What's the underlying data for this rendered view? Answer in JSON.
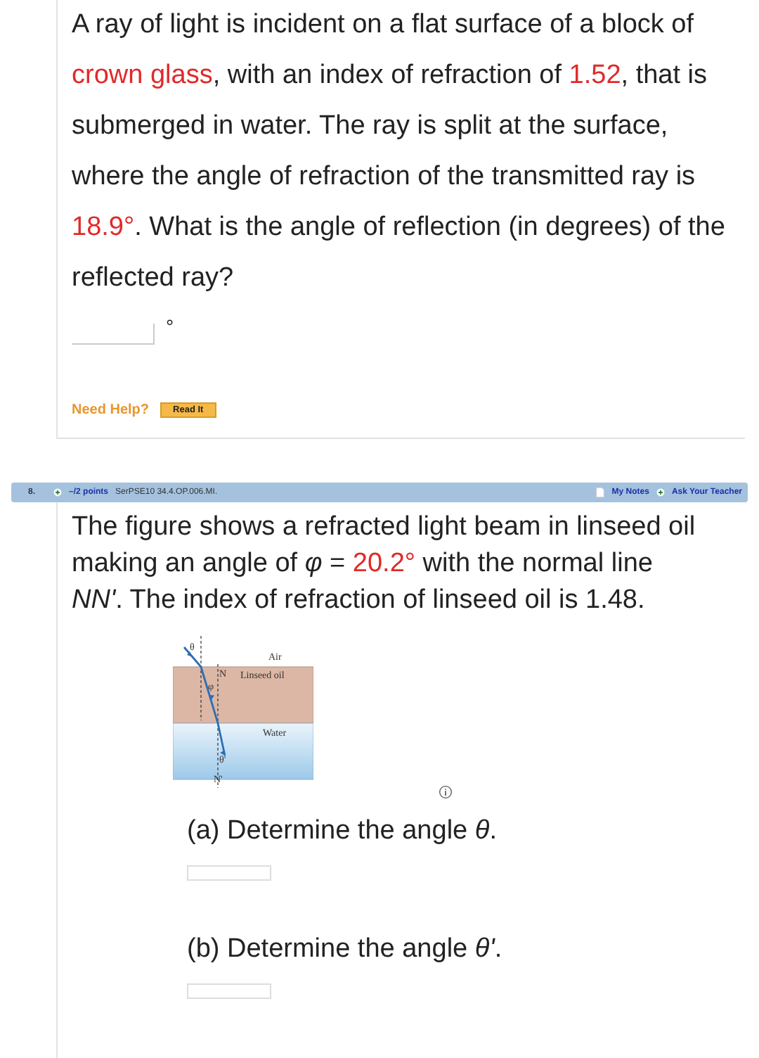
{
  "question_1": {
    "text": [
      {
        "text": "A ray of light is incident on a flat surface of a block of ",
        "highlight": false
      },
      {
        "text": "crown glass",
        "highlight": true
      },
      {
        "text": ", with an index of refraction of ",
        "highlight": false
      },
      {
        "text": "1.52",
        "highlight": true
      },
      {
        "text": ", that is submerged in water. The ray is split at the surface, where the angle of refraction of the transmitted ray is ",
        "highlight": false
      },
      {
        "text": "18.9°",
        "highlight": true
      },
      {
        "text": ". What is the angle of reflection (in degrees) of the reflected ray?",
        "highlight": false
      }
    ],
    "unit": "°",
    "help_label": "Need Help?",
    "help_button": "Read It"
  },
  "question_2": {
    "header": {
      "number": "8.",
      "points": "–/2 points",
      "code": "SerPSE10 34.4.OP.006.MI.",
      "notes": "My Notes",
      "ask": "Ask Your Teacher"
    },
    "text": [
      {
        "text": "The figure shows a refracted light beam in linseed oil making an angle of *φ* = ",
        "highlight": false
      },
      {
        "text": "20.2°",
        "highlight": true
      },
      {
        "text": " with the normal line *NN'*. The index of refraction of linseed oil is 1.48.",
        "highlight": false
      }
    ],
    "figure": {
      "air": "Air",
      "oil": "Linseed oil",
      "water": "Water",
      "theta": "θ",
      "phi": "φ",
      "n": "N",
      "n_prime": "N'",
      "theta_prime": "θ'"
    },
    "parts": [
      {
        "text": "(a) Determine the angle *θ*."
      },
      {
        "text": "(b) Determine the angle *θ'*."
      }
    ]
  }
}
